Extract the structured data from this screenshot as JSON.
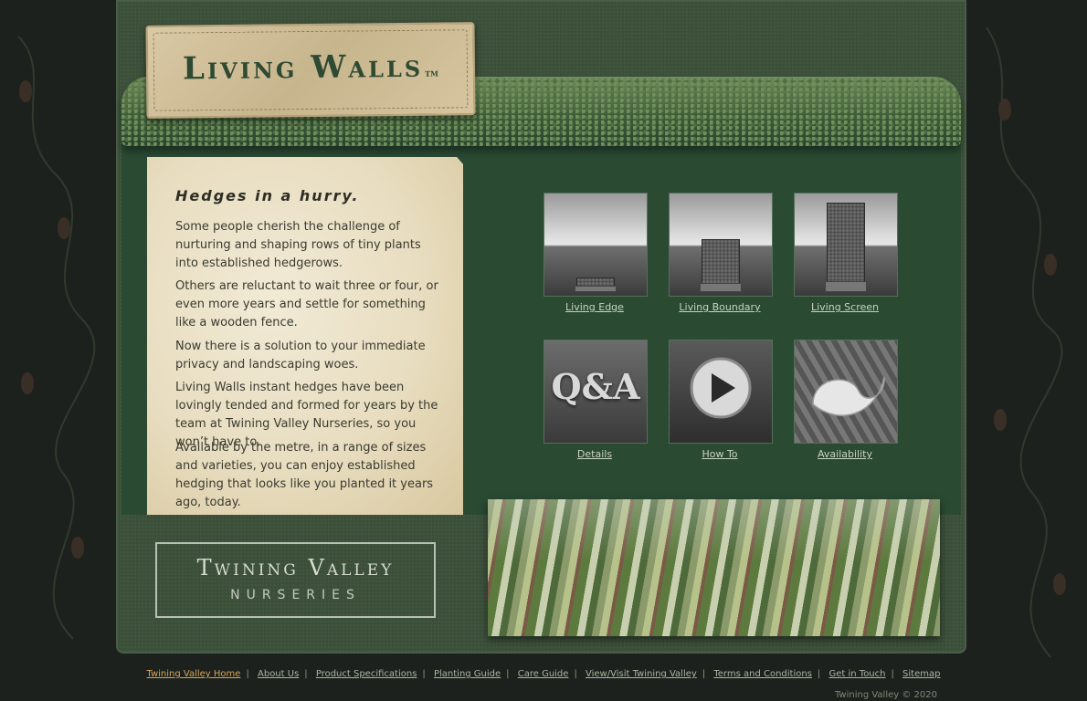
{
  "logo": {
    "title": "Living Walls",
    "tm": "TM"
  },
  "intro": {
    "heading": "Hedges in a hurry.",
    "paragraphs": [
      "Some people cherish the challenge of nurturing and shaping rows of tiny plants into established hedgerows.",
      "Others are reluctant to wait three or four, or even more years and settle for something like a wooden fence.",
      "Now there is a solution to your immediate privacy and landscaping woes.",
      "Living Walls instant hedges have been lovingly tended and formed for years by the team at Twining Valley Nurseries, so you won’t have to.",
      "Available by the metre, in a range of sizes and varieties, you can enjoy established hedging that looks like you planted it years ago, today."
    ]
  },
  "products": [
    {
      "label": "Living Edge",
      "icon": "low-hedge-image"
    },
    {
      "label": "Living Boundary",
      "icon": "medium-hedge-image"
    },
    {
      "label": "Living Screen",
      "icon": "tall-hedge-image"
    },
    {
      "label": "Details",
      "icon": "qa-image",
      "overlay": "Q&A"
    },
    {
      "label": "How To",
      "icon": "play-video-image"
    },
    {
      "label": "Availability",
      "icon": "availability-image"
    }
  ],
  "nursery": {
    "name": "Twining Valley",
    "sub": "NURSERIES"
  },
  "footer": {
    "links": [
      "Twining Valley Home",
      "About Us",
      "Product Specifications",
      "Planting Guide",
      "Care Guide",
      "View/Visit Twining Valley",
      "Terms and Conditions",
      "Get in Touch",
      "Sitemap"
    ],
    "active_color": "#d9a655",
    "copyright": "Twining Valley © 2020"
  }
}
